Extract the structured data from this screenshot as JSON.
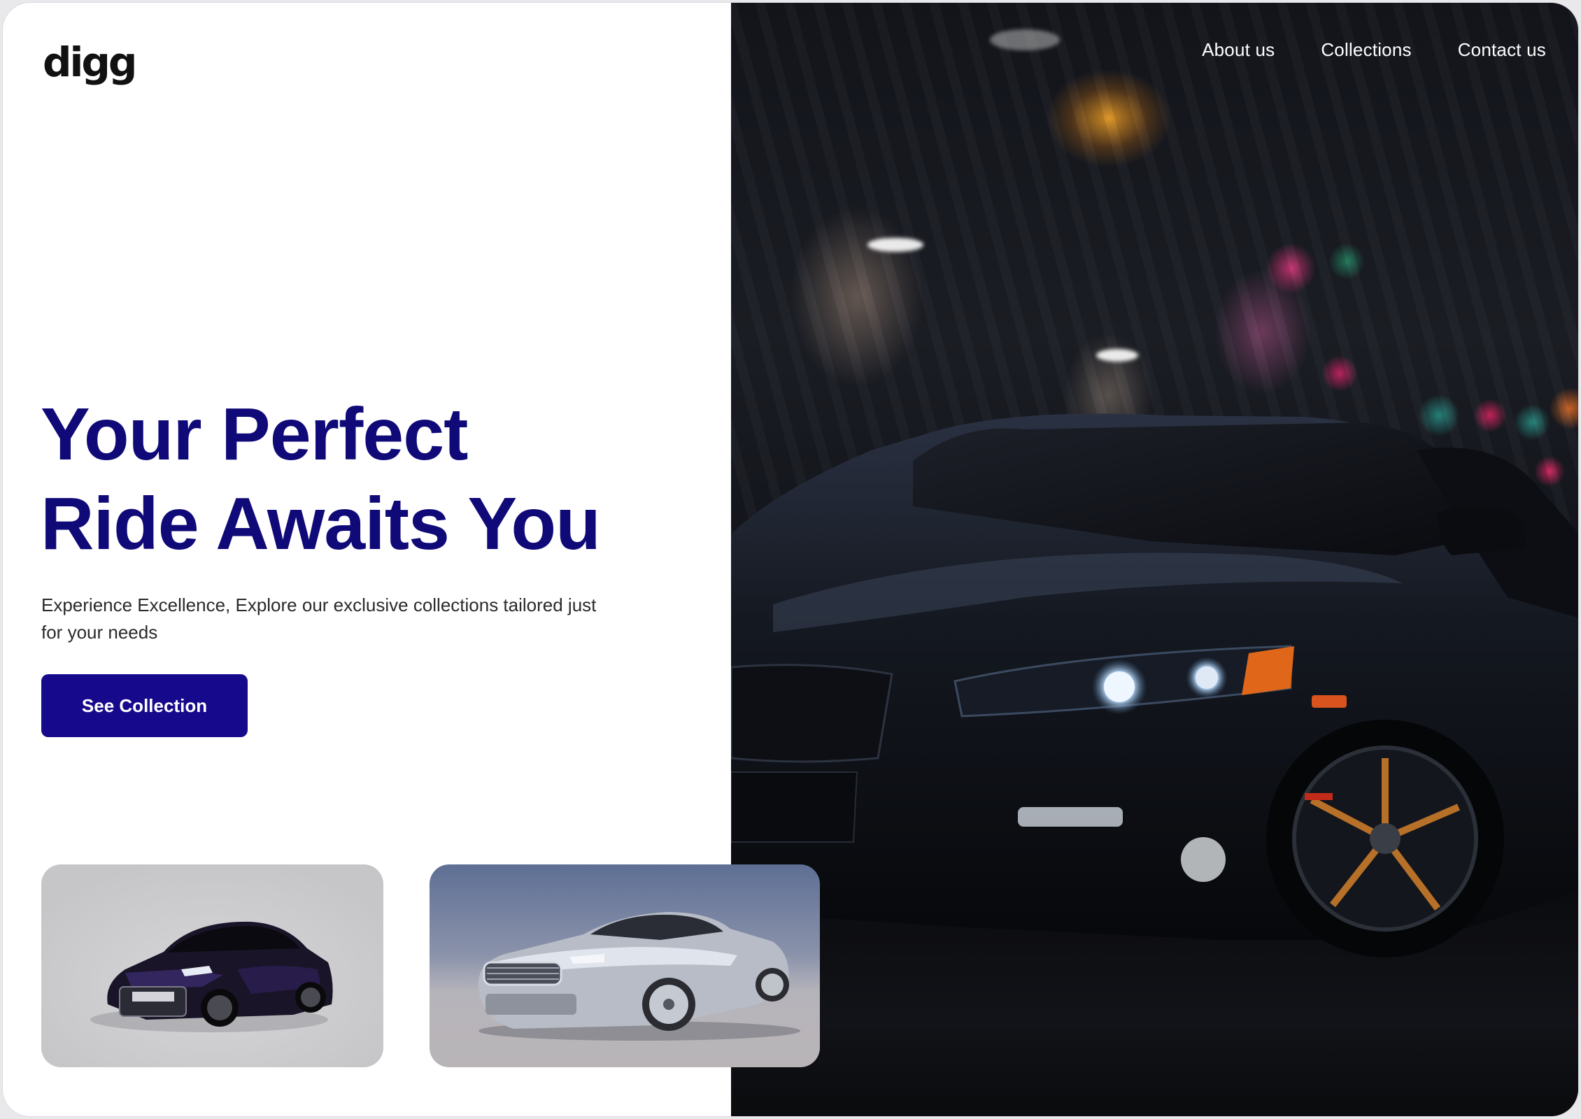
{
  "brand": {
    "logo_text": "digg"
  },
  "nav": {
    "items": [
      {
        "label": "About us"
      },
      {
        "label": "Collections"
      },
      {
        "label": "Contact us"
      }
    ]
  },
  "hero": {
    "headline_line1": "Your Perfect",
    "headline_line2": "Ride Awaits You",
    "subtext": "Experience Excellence, Explore our exclusive collections tailored just for your needs",
    "cta_label": "See Collection",
    "image": "black-sedan-night-street-photo"
  },
  "thumbnails": [
    {
      "image": "dark-purple-sedan-photo"
    },
    {
      "image": "silver-sports-coupe-photo"
    }
  ],
  "colors": {
    "headline": "#100a78",
    "cta_background": "#17098c",
    "cta_text": "#ffffff",
    "nav_text": "#ffffff",
    "page_background": "#ffffff"
  }
}
